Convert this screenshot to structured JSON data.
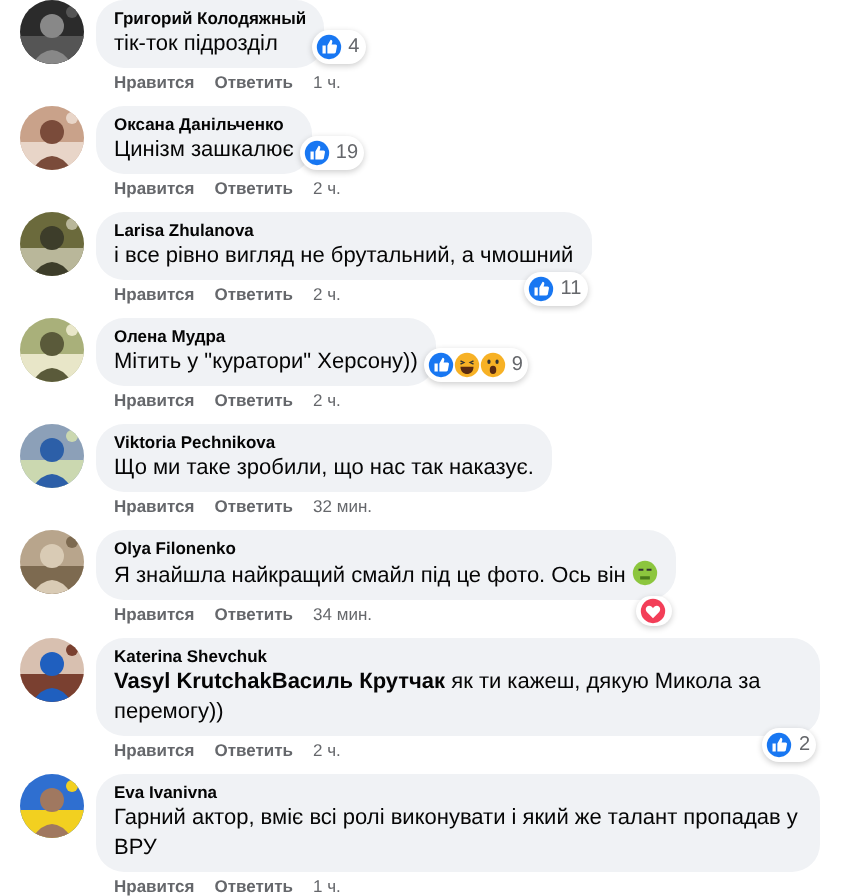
{
  "comments": [
    {
      "author": "Григорий Колодяжный",
      "text": "тік-ток підрозділ",
      "reactions": [
        {
          "kind": "like"
        }
      ],
      "reaction_count": "4",
      "actions": [
        "Нравится",
        "Ответить"
      ],
      "time": "1 ч."
    },
    {
      "author": "Оксана Данільченко",
      "text": "Цинізм зашкалює",
      "reactions": [
        {
          "kind": "like"
        }
      ],
      "reaction_count": "19",
      "actions": [
        "Нравится",
        "Ответить"
      ],
      "time": "2 ч."
    },
    {
      "author": "Larisa Zhulanova",
      "text": "і все рівно вигляд не брутальний, а чмошний",
      "reactions": [
        {
          "kind": "like"
        }
      ],
      "reaction_count": "11",
      "actions": [
        "Нравится",
        "Ответить"
      ],
      "time": "2 ч."
    },
    {
      "author": "Олена Мудра",
      "text": "Мітить у \"куратори\" Херсону))",
      "reactions": [
        {
          "kind": "like"
        },
        {
          "kind": "haha"
        },
        {
          "kind": "wow"
        }
      ],
      "reaction_count": "9",
      "actions": [
        "Нравится",
        "Ответить"
      ],
      "time": "2 ч."
    },
    {
      "author": "Viktoria Pechnikova",
      "text": "Що ми таке зробили, що нас так наказує.",
      "actions": [
        "Нравится",
        "Ответить"
      ],
      "time": "32 мин."
    },
    {
      "author": "Olya Filonenko",
      "text": "Я знайшла найкращий смайл під це фото. Ось він",
      "trailing_emoji": true,
      "reactions": [
        {
          "kind": "love"
        }
      ],
      "actions": [
        "Нравится",
        "Ответить"
      ],
      "time": "34 мин."
    },
    {
      "author": "Katerina Shevchuk",
      "text": "**Vasyl KrutchakВасиль Крутчак** як ти кажеш, дякую Микола за перемогу))",
      "reactions": [
        {
          "kind": "like"
        }
      ],
      "reaction_count": "2",
      "actions": [
        "Нравится",
        "Ответить"
      ],
      "time": "2 ч."
    },
    {
      "author": "Eva Ivanivna",
      "text": "Гарний актор, вміє всі ролі виконувати і який же талант пропадав у ВРУ",
      "actions": [
        "Нравится",
        "Ответить"
      ],
      "time": "1 ч."
    }
  ]
}
